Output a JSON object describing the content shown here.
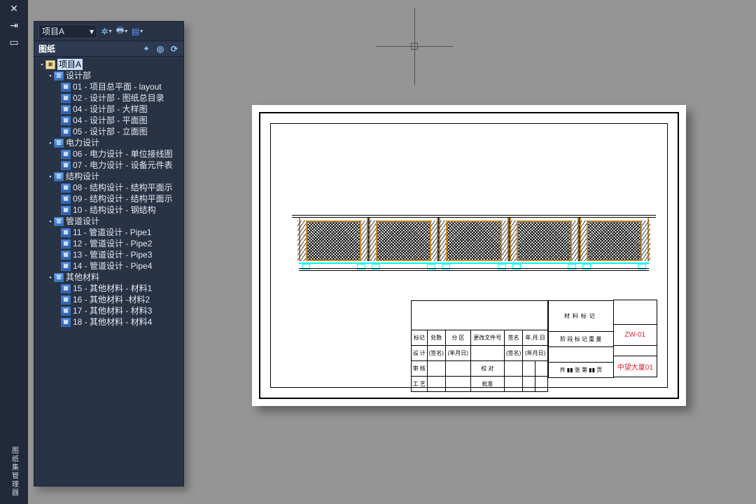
{
  "dock": {
    "close": "✕",
    "pin": "⇥",
    "tab": "▭",
    "vlabel": "图纸集管理器"
  },
  "toolbar": {
    "project_selected": "项目A",
    "caret": "▾"
  },
  "section": {
    "title": "图纸",
    "icons": {
      "sync": "⟳",
      "eye": "◎",
      "home": "⌖"
    }
  },
  "tree": {
    "root": "项目A",
    "groups": [
      {
        "label": "设计部",
        "items": [
          "01 - 项目总平面 - layout",
          "02 - 设计部 - 图纸总目录",
          "04 - 设计部 - 大样图",
          "04 - 设计部 - 平面图",
          "05 - 设计部 - 立面图"
        ]
      },
      {
        "label": "电力设计",
        "items": [
          "06 - 电力设计 - 单位接线图",
          "07 - 电力设计 - 设备元件表"
        ]
      },
      {
        "label": "结构设计",
        "items": [
          "08 - 结构设计 - 结构平面示",
          "09 - 结构设计 - 结构平面示",
          "10 - 结构设计 - 钢结构"
        ]
      },
      {
        "label": "管道设计",
        "items": [
          "11 - 管道设计 - Pipe1",
          "12 - 管道设计 - Pipe2",
          "13 - 管道设计 - Pipe3",
          "14 - 管道设计 - Pipe4"
        ]
      },
      {
        "label": "其他材料",
        "items": [
          "15 - 其他材料 - 材料1",
          "16 - 其他材料 -材料2",
          "17 - 其他材料 - 材料3",
          "18 - 其他材料 - 材料4"
        ]
      }
    ]
  },
  "titleblock": {
    "big": "材料标记",
    "dwgno": "ZW-01",
    "company": "中望大厦01",
    "rowA": {
      "r1": [
        "标记",
        "处数",
        "分 区",
        "更改文件号",
        "签名",
        "年.月.日"
      ],
      "r2": [
        "设 计",
        "(签名)",
        "(年月日)",
        "",
        "(签名)",
        "(年月日)"
      ],
      "r2b": "阶 段 标 记   重 量",
      "r3a": "审 核",
      "r3b": "校 对",
      "r4a": "工 艺",
      "r4b": "批准",
      "scale": "共 ▮▮ 张   第 ▮▮ 页"
    }
  }
}
